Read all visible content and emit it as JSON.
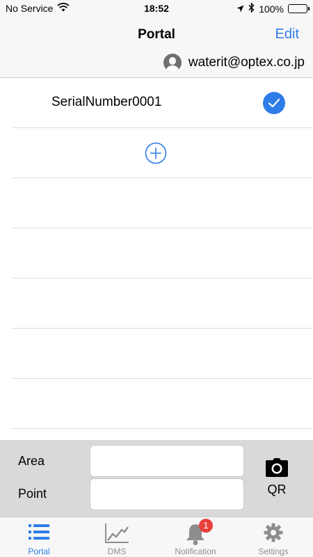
{
  "status_bar": {
    "carrier": "No Service",
    "time": "18:52",
    "battery": "100%",
    "icons": [
      "wifi-icon",
      "location-arrow-icon",
      "bluetooth-icon",
      "battery-icon"
    ]
  },
  "nav": {
    "title": "Portal",
    "edit_label": "Edit"
  },
  "user": {
    "email": "waterit@optex.co.jp",
    "icon": "avatar-icon"
  },
  "list": {
    "items": [
      {
        "serial": "SerialNumber0001",
        "selected": true
      }
    ],
    "add_icon": "plus-circle-icon"
  },
  "form": {
    "area_label": "Area",
    "area_value": "",
    "point_label": "Point",
    "point_value": "",
    "qr_label": "QR",
    "qr_icon": "camera-icon"
  },
  "tabs": [
    {
      "label": "Portal",
      "icon": "list-icon",
      "active": true
    },
    {
      "label": "DMS",
      "icon": "chart-icon",
      "active": false
    },
    {
      "label": "Notification",
      "icon": "bell-icon",
      "active": false,
      "badge": "1"
    },
    {
      "label": "Settings",
      "icon": "gear-icon",
      "active": false
    }
  ],
  "colors": {
    "accent": "#2f7ce8",
    "badge": "#e8403a",
    "panel": "#d9d9d9"
  }
}
